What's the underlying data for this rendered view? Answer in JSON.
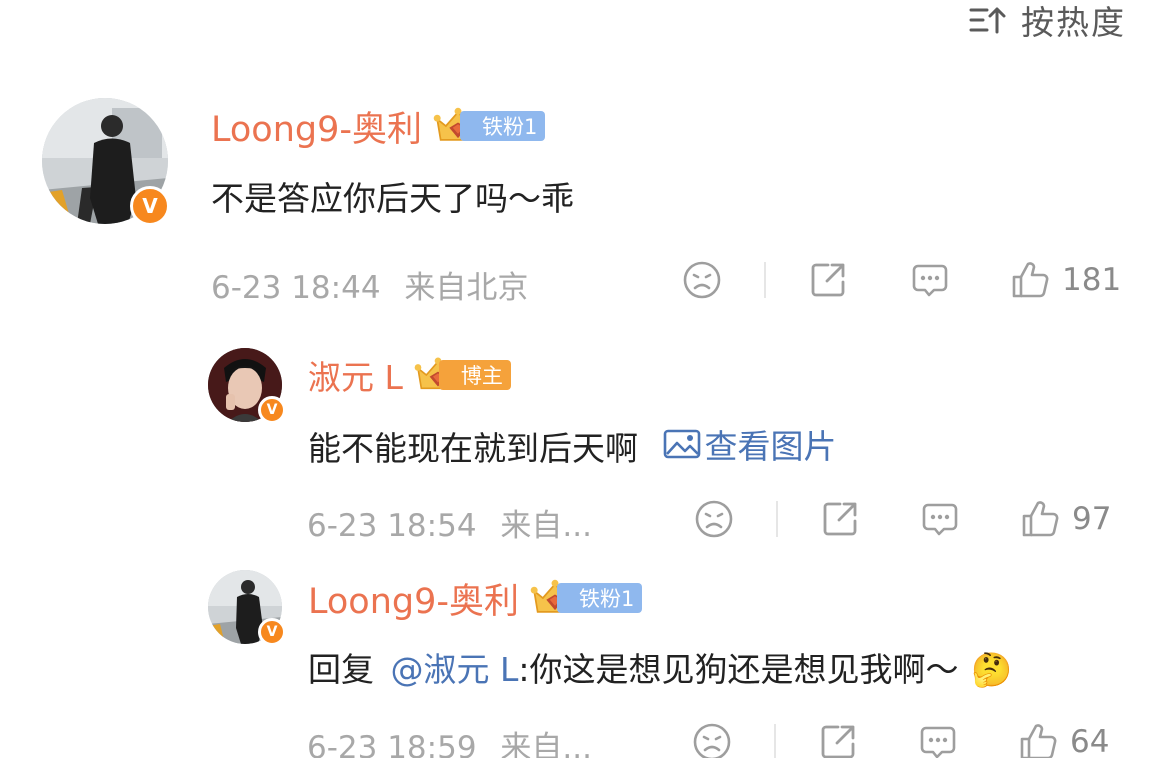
{
  "sort": {
    "label": "按热度",
    "icon": "sort-icon"
  },
  "comments": [
    {
      "username": "Loong9-奥利",
      "badge_level": "6",
      "badge_label": "铁粉1",
      "text": "不是答应你后天了吗～乖",
      "time": "6-23 18:44",
      "location": "来自北京",
      "likes": "181"
    }
  ],
  "replies": [
    {
      "username": "淑元 L",
      "badge_level": "2",
      "badge_label": "博主",
      "text": "能不能现在就到后天啊",
      "view_image": "查看图片",
      "time": "6-23 18:54",
      "location": "来自...",
      "likes": "97"
    },
    {
      "username": "Loong9-奥利",
      "badge_level": "6",
      "badge_label": "铁粉1",
      "reply_prefix": "回复",
      "mention": "@淑元 L",
      "text": ":你这是想见狗还是想见我啊～",
      "emoji": "🤔",
      "time": "6-23 18:59",
      "location": "来自...",
      "likes": "64"
    }
  ],
  "icons": {
    "dislike": "sad-face-icon",
    "share": "share-icon",
    "comment": "comment-icon",
    "like": "thumbs-up-icon",
    "view_image": "image-icon"
  },
  "colors": {
    "username": "#eb7350",
    "link": "#4a74b5",
    "meta": "#a8a8a8",
    "verified": "#f7881e",
    "fan_badge": "#8fb8ee",
    "blogger_badge": "#f5a23b"
  }
}
